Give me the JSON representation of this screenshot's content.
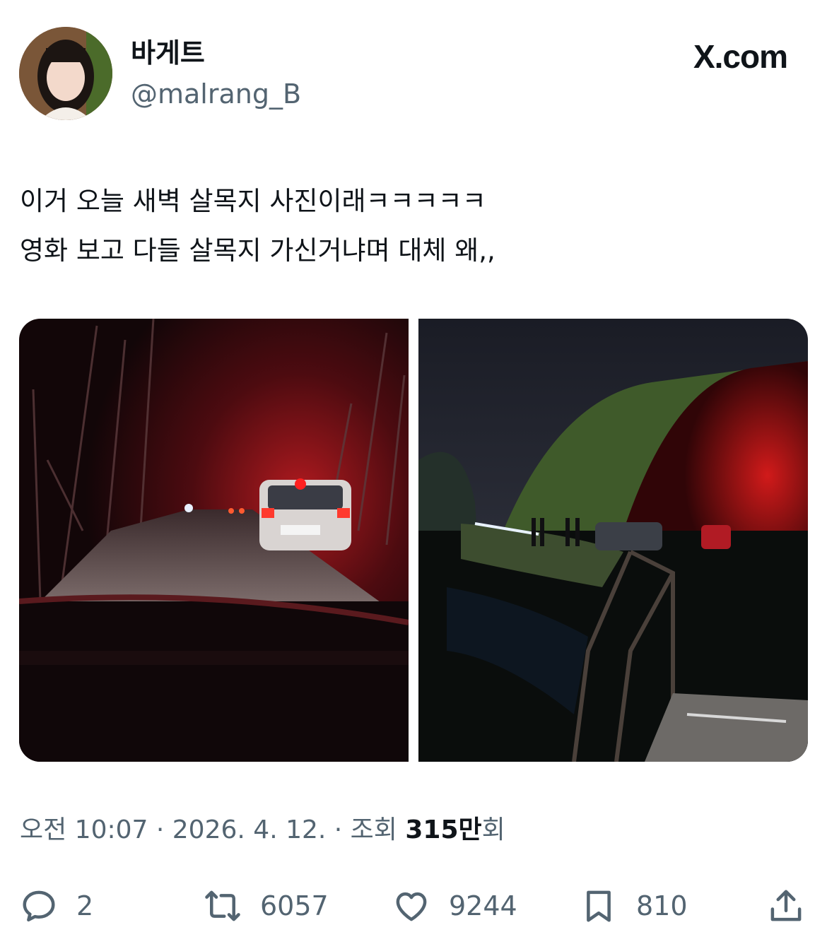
{
  "author": {
    "name": "바게트",
    "handle": "@malrang_B"
  },
  "brand": {
    "label": "X.com"
  },
  "tweet": {
    "line1": "이거 오늘 새벽 살목지 사진이래ㅋㅋㅋㅋㅋ",
    "line2": "영화 보고 다들 살목지 가신거냐며 대체 왜,,"
  },
  "meta": {
    "time": "오전 10:07",
    "sep1": " · ",
    "date": "2026. 4. 12.",
    "sep2": " · ",
    "views_label": "조회 ",
    "views_value": "315만",
    "views_suffix": "회"
  },
  "actions": {
    "replies": "2",
    "reposts": "6057",
    "likes": "9244",
    "bookmarks": "810"
  },
  "colors": {
    "text": "#0f1419",
    "secondary": "#536471",
    "background": "#ffffff"
  }
}
